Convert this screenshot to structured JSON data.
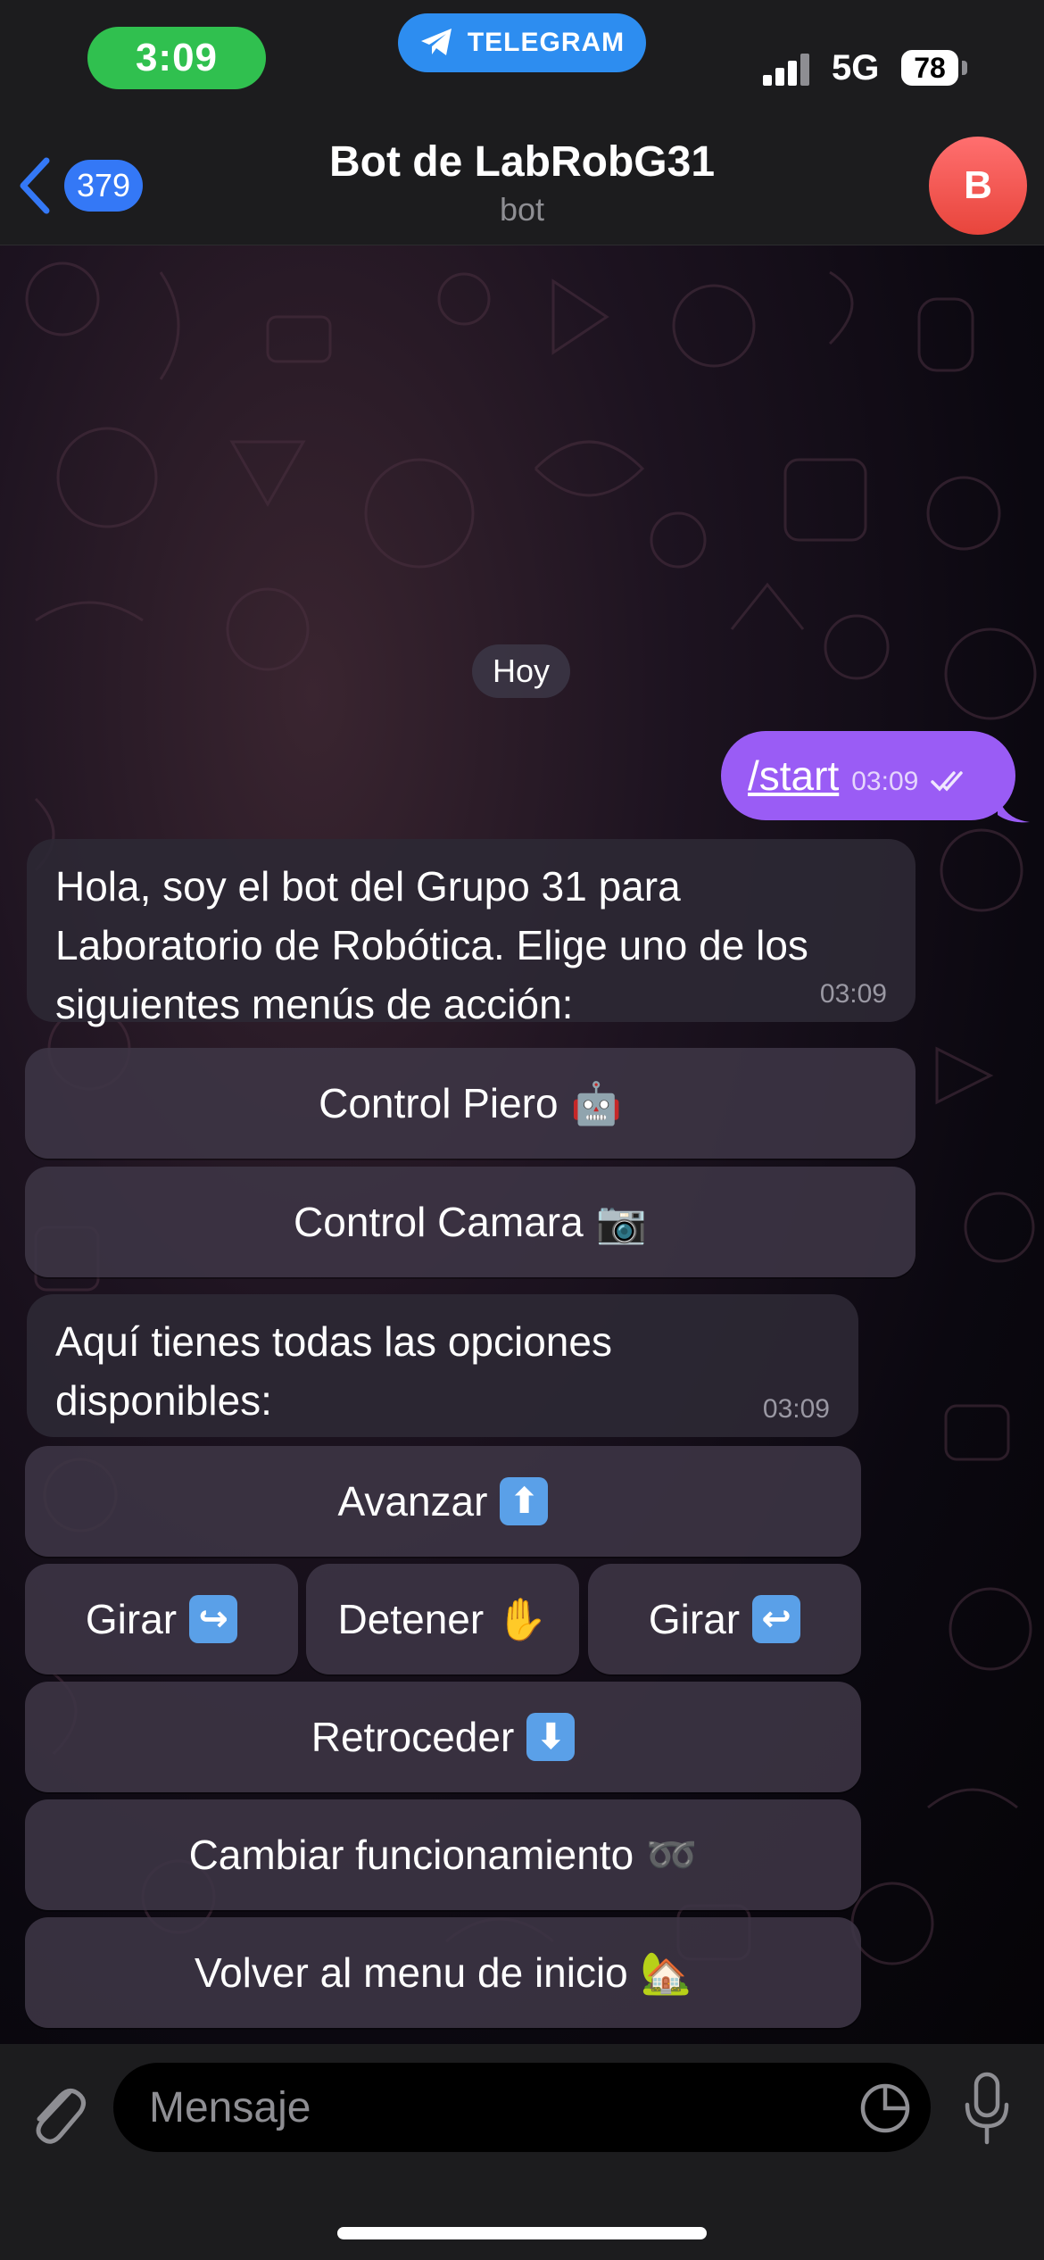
{
  "status_bar": {
    "time": "3:09",
    "app_pill": "TELEGRAM",
    "network": "5G",
    "battery": "78"
  },
  "header": {
    "back_count": "379",
    "title": "Bot de LabRobG31",
    "subtitle": "bot",
    "avatar_letter": "B"
  },
  "chat": {
    "date_label": "Hoy",
    "outgoing": {
      "text": "/start",
      "time": "03:09"
    },
    "message1": {
      "text": "Hola, soy el bot del Grupo 31 para Laboratorio de Robótica. Elige uno de los siguientes menús de acción:",
      "time": "03:09",
      "buttons": [
        {
          "label": "Control Piero",
          "emoji": "🤖"
        },
        {
          "label": "Control Camara",
          "emoji": "📷"
        }
      ]
    },
    "message2": {
      "text": "Aquí tienes todas las opciones disponibles:",
      "time": "03:09",
      "buttons": {
        "forward": {
          "label": "Avanzar",
          "emoji": "⬆"
        },
        "turn_left": {
          "label": "Girar",
          "emoji": "↪"
        },
        "stop": {
          "label": "Detener",
          "emoji": "✋"
        },
        "turn_right": {
          "label": "Girar",
          "emoji": "↩"
        },
        "backward": {
          "label": "Retroceder",
          "emoji": "⬇"
        },
        "change_mode": {
          "label": "Cambiar funcionamiento",
          "emoji": "➿"
        },
        "back_home": {
          "label": "Volver al menu de inicio",
          "emoji": "🏡"
        }
      }
    }
  },
  "input": {
    "placeholder": "Mensaje"
  },
  "colors": {
    "accent": "#3478f6",
    "outgoing_bubble": "#9a5cf5",
    "time_pill": "#30c04f",
    "telegram_pill": "#2d8df0",
    "avatar": "#e8453c"
  },
  "icons": [
    "back-chevron-icon",
    "telegram-icon",
    "signal-icon",
    "battery-icon",
    "double-check-icon",
    "paperclip-icon",
    "sticker-icon",
    "microphone-icon"
  ]
}
